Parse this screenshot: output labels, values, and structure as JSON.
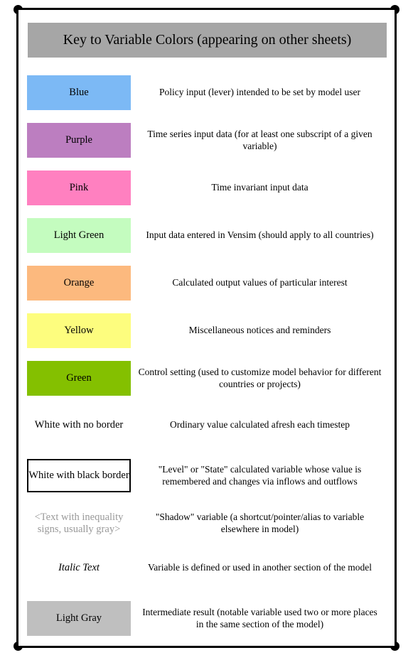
{
  "title": "Key to Variable Colors (appearing on other sheets)",
  "colors": {
    "banner_bg": "#a6a6a6",
    "frame": "#000000",
    "shadow_text": "#999999"
  },
  "rows": [
    {
      "label": "Blue",
      "style": "filled",
      "bg": "#7cb9f5",
      "description": "Policy input (lever) intended to be set by model user"
    },
    {
      "label": "Purple",
      "style": "filled",
      "bg": "#bc7ec0",
      "description": "Time series input data (for at least one subscript of a given variable)"
    },
    {
      "label": "Pink",
      "style": "filled",
      "bg": "#ff80c0",
      "description": "Time invariant input data"
    },
    {
      "label": "Light Green",
      "style": "filled",
      "bg": "#c4fcbf",
      "description": "Input data entered in Vensim (should apply to all countries)"
    },
    {
      "label": "Orange",
      "style": "filled",
      "bg": "#fcb97e",
      "description": "Calculated output values of particular interest"
    },
    {
      "label": "Yellow",
      "style": "filled",
      "bg": "#fdfd7e",
      "description": "Miscellaneous notices and reminders"
    },
    {
      "label": "Green",
      "style": "filled",
      "bg": "#84c000",
      "description": "Control setting (used to customize model behavior for different countries or projects)"
    },
    {
      "label": "White with no border",
      "style": "plain",
      "bg": "#ffffff",
      "description": "Ordinary value calculated afresh each timestep"
    },
    {
      "label": "White with black border",
      "style": "boxed",
      "bg": "#ffffff",
      "description": "\"Level\" or \"State\" calculated variable whose value is remembered and changes via inflows and outflows"
    },
    {
      "label": "<Text with inequality signs, usually gray>",
      "style": "shadow",
      "bg": "#ffffff",
      "description": "\"Shadow\" variable (a shortcut/pointer/alias to variable elsewhere in model)"
    },
    {
      "label": "Italic Text",
      "style": "italic",
      "bg": "#ffffff",
      "description": "Variable is defined or used in another section of the model"
    },
    {
      "label": "Light Gray",
      "style": "filled",
      "bg": "#bfbfbf",
      "description": "Intermediate result (notable variable used two or more places in the same section of the model)"
    }
  ]
}
